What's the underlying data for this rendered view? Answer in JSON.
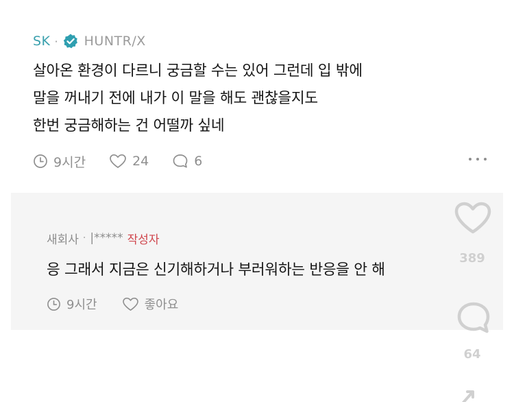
{
  "comment": {
    "author": "SK",
    "group": "HUNTR/X",
    "lines": [
      "살아온 환경이 다르니 궁금할 수는 있어 그런데 입 밖에",
      "말을 꺼내기 전에 내가 이 말을 해도 괜찮을지도",
      "한번 궁금해하는 건 어떨까 싶네"
    ],
    "time": "9시간",
    "likes": "24",
    "replies": "6"
  },
  "reply": {
    "author": "새회사",
    "masked_name": "|*****",
    "badge": "작성자",
    "text": "응 그래서 지금은 신기해하거나 부러워하는 반응을 안 해",
    "time": "9시간",
    "like_label": "좋아요"
  },
  "overlay": {
    "like_count": "389",
    "comment_count": "64"
  },
  "colors": {
    "author_accent": "#3aa0ad",
    "verified_badge": "#2f9fb0",
    "creator_badge": "#d0474e",
    "reply_bg": "#f5f5f5"
  }
}
